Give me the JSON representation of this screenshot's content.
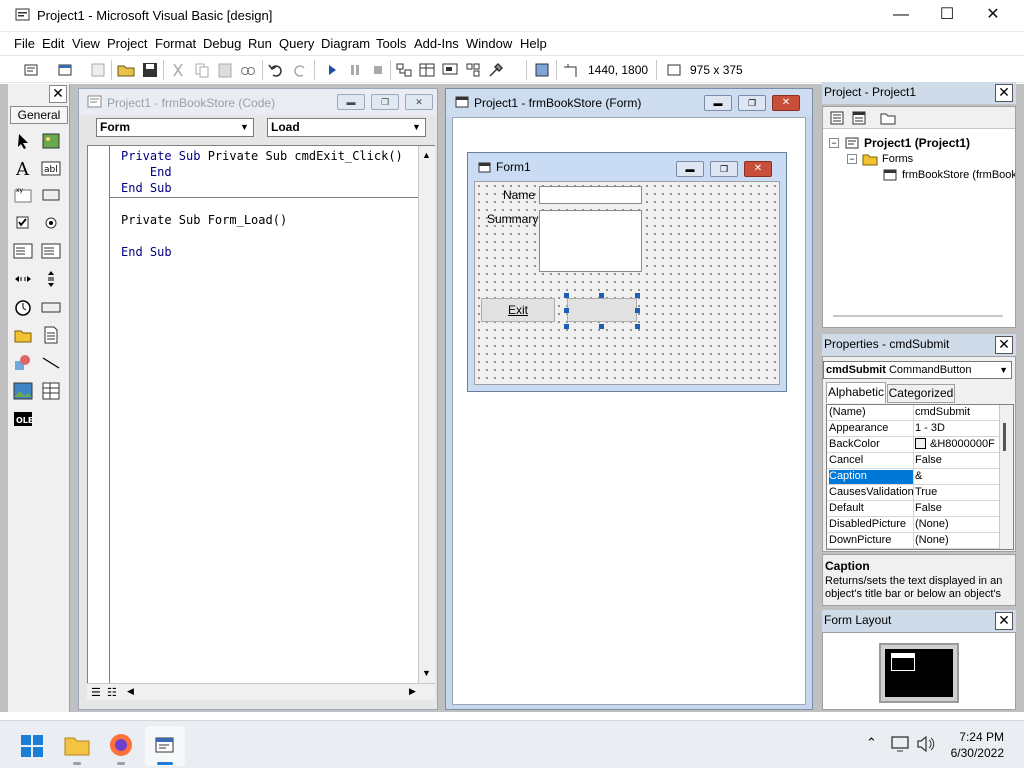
{
  "window": {
    "title": "Project1 - Microsoft Visual Basic [design]"
  },
  "menu": [
    "File",
    "Edit",
    "View",
    "Project",
    "Format",
    "Debug",
    "Run",
    "Query",
    "Diagram",
    "Tools",
    "Add-Ins",
    "Window",
    "Help"
  ],
  "toolbar": {
    "position_readout": "1440, 1800",
    "size_readout": "975 x 375"
  },
  "toolbox": {
    "tab_label": "General"
  },
  "code_window": {
    "title": "Project1 - frmBookStore (Code)",
    "object_dropdown": "Form",
    "procedure_dropdown": "Load",
    "lines": [
      "Private Sub cmdExit_Click()",
      "    End",
      "End Sub",
      "Private Sub Form_Load()",
      "",
      "End Sub"
    ]
  },
  "form_window": {
    "title": "Project1 - frmBookStore (Form)",
    "form_caption": "Form1",
    "name_label": "Name",
    "summary_label": "Summary",
    "exit_button": "Exit",
    "submit_button": ""
  },
  "project_pane": {
    "title": "Project - Project1",
    "root": "Project1 (Project1)",
    "folder": "Forms",
    "item": "frmBookStore (frmBookStore)"
  },
  "properties_pane": {
    "title": "Properties - cmdSubmit",
    "object_name": "cmdSubmit",
    "object_type": "CommandButton",
    "tab_alphabetic": "Alphabetic",
    "tab_categorized": "Categorized",
    "rows": [
      {
        "name": "(Name)",
        "value": "cmdSubmit"
      },
      {
        "name": "Appearance",
        "value": "1 - 3D"
      },
      {
        "name": "BackColor",
        "value": "&H8000000F"
      },
      {
        "name": "Cancel",
        "value": "False"
      },
      {
        "name": "Caption",
        "value": "&"
      },
      {
        "name": "CausesValidation",
        "value": "True"
      },
      {
        "name": "Default",
        "value": "False"
      },
      {
        "name": "DisabledPicture",
        "value": "(None)"
      },
      {
        "name": "DownPicture",
        "value": "(None)"
      }
    ],
    "selected_row": 4,
    "desc_title": "Caption",
    "desc_text": "Returns/sets the text displayed in an object's title bar or below an object's"
  },
  "form_layout_pane": {
    "title": "Form Layout"
  },
  "taskbar": {
    "time": "7:24 PM",
    "date": "6/30/2022"
  },
  "colors": {
    "selection": "#0078d7",
    "handle": "#1e5fb4",
    "keyword": "#00007f"
  }
}
